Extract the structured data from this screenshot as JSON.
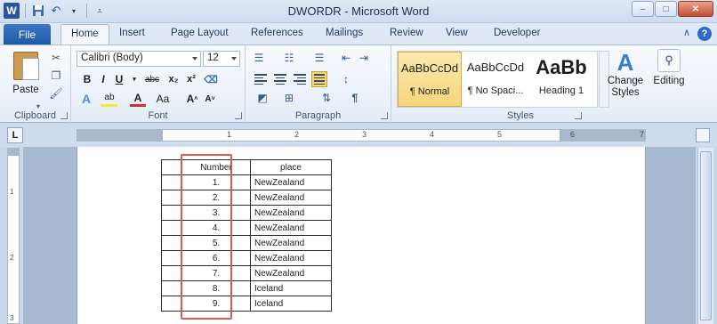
{
  "app": {
    "title": "DWORDR - Microsoft Word",
    "icon": "word-icon"
  },
  "quick_access": [
    "save-icon",
    "undo-icon",
    "customize-icon"
  ],
  "window_controls": {
    "minimize": "–",
    "restore": "□",
    "close": "✕"
  },
  "ribbon_tabs": [
    {
      "label": "File"
    },
    {
      "label": "Home",
      "active": true
    },
    {
      "label": "Insert"
    },
    {
      "label": "Page Layout"
    },
    {
      "label": "References"
    },
    {
      "label": "Mailings"
    },
    {
      "label": "Review"
    },
    {
      "label": "View"
    },
    {
      "label": "Developer"
    }
  ],
  "groups": {
    "clipboard": {
      "label": "Clipboard",
      "paste": "Paste"
    },
    "font": {
      "label": "Font",
      "font_name": "Calibri (Body)",
      "font_size": "12"
    },
    "paragraph": {
      "label": "Paragraph"
    },
    "styles": {
      "label": "Styles",
      "items": [
        {
          "sample": "AaBbCcDd",
          "name": "¶ Normal"
        },
        {
          "sample": "AaBbCcDd",
          "name": "¶ No Spaci..."
        },
        {
          "sample": "AaBb",
          "name": "Heading 1"
        }
      ],
      "change_styles": "Change Styles",
      "editing": "Editing"
    }
  },
  "ruler": {
    "numbers": [
      "1",
      "2",
      "3",
      "4",
      "5",
      "6",
      "7"
    ],
    "vnumbers": [
      "1",
      "2",
      "3"
    ]
  },
  "table": {
    "headers": [
      "",
      "Number",
      "place"
    ],
    "rows": [
      [
        "",
        "1.",
        "NewZealand"
      ],
      [
        "",
        "2.",
        "NewZealand"
      ],
      [
        "",
        "3.",
        "NewZealand"
      ],
      [
        "",
        "4.",
        "NewZealand"
      ],
      [
        "",
        "5.",
        "NewZealand"
      ],
      [
        "",
        "6.",
        "NewZealand"
      ],
      [
        "",
        "7.",
        "NewZealand"
      ],
      [
        "",
        "8.",
        "Iceland"
      ],
      [
        "",
        "9.",
        "Iceland"
      ]
    ]
  },
  "colors": {
    "highlight_box": "#e05a4b",
    "file_tab": "#2b579a",
    "selected_style": "#f8d57c"
  }
}
